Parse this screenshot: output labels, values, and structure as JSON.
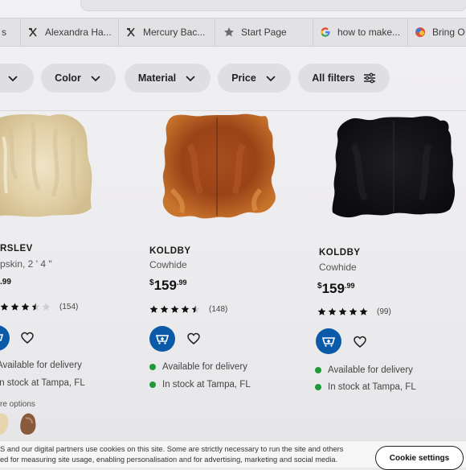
{
  "browser": {
    "tabs": [
      {
        "title": "s",
        "icon": "none"
      },
      {
        "title": "Alexandra Ha...",
        "icon": "site-favicon-icon"
      },
      {
        "title": "Mercury Bac...",
        "icon": "site-favicon-icon"
      },
      {
        "title": "Start Page",
        "icon": "star-icon"
      },
      {
        "title": "how to make...",
        "icon": "google-icon"
      },
      {
        "title": "Bring O",
        "icon": "colorful-favicon-icon"
      }
    ]
  },
  "filters": [
    {
      "label": ""
    },
    {
      "label": "Color"
    },
    {
      "label": "Material"
    },
    {
      "label": "Price"
    },
    {
      "label": "All filters"
    }
  ],
  "products": [
    {
      "brand": "RSLEV",
      "desc": "pskin, 2 ' 4 \"",
      "price_currency": "",
      "price_main": ".99",
      "price_cents": "",
      "rating": 3.5,
      "reviews": "(154)",
      "availability": [
        "Available for delivery",
        "In stock at Tampa, FL"
      ],
      "more_options": "re options"
    },
    {
      "brand": "KOLDBY",
      "desc": "Cowhide",
      "price_currency": "$",
      "price_main": "159",
      "price_cents": ".99",
      "rating": 4.5,
      "reviews": "(148)",
      "availability": [
        "Available for delivery",
        "In stock at Tampa, FL"
      ]
    },
    {
      "brand": "KOLDBY",
      "desc": "Cowhide",
      "price_currency": "$",
      "price_main": "159",
      "price_cents": ".99",
      "rating": 5,
      "reviews": "(99)",
      "availability": [
        "Available for delivery",
        "In stock at Tampa, FL"
      ]
    }
  ],
  "cookie": {
    "line1": "S and our digital partners use cookies on this site. Some are strictly necessary to run the site and others",
    "line2": "ed for measuring site usage, enabling personalisation and for advertising, marketing and social media.",
    "button": "Cookie settings"
  },
  "colors": {
    "accent_blue": "#0b5aa8",
    "stock_green": "#1f9a3a"
  }
}
